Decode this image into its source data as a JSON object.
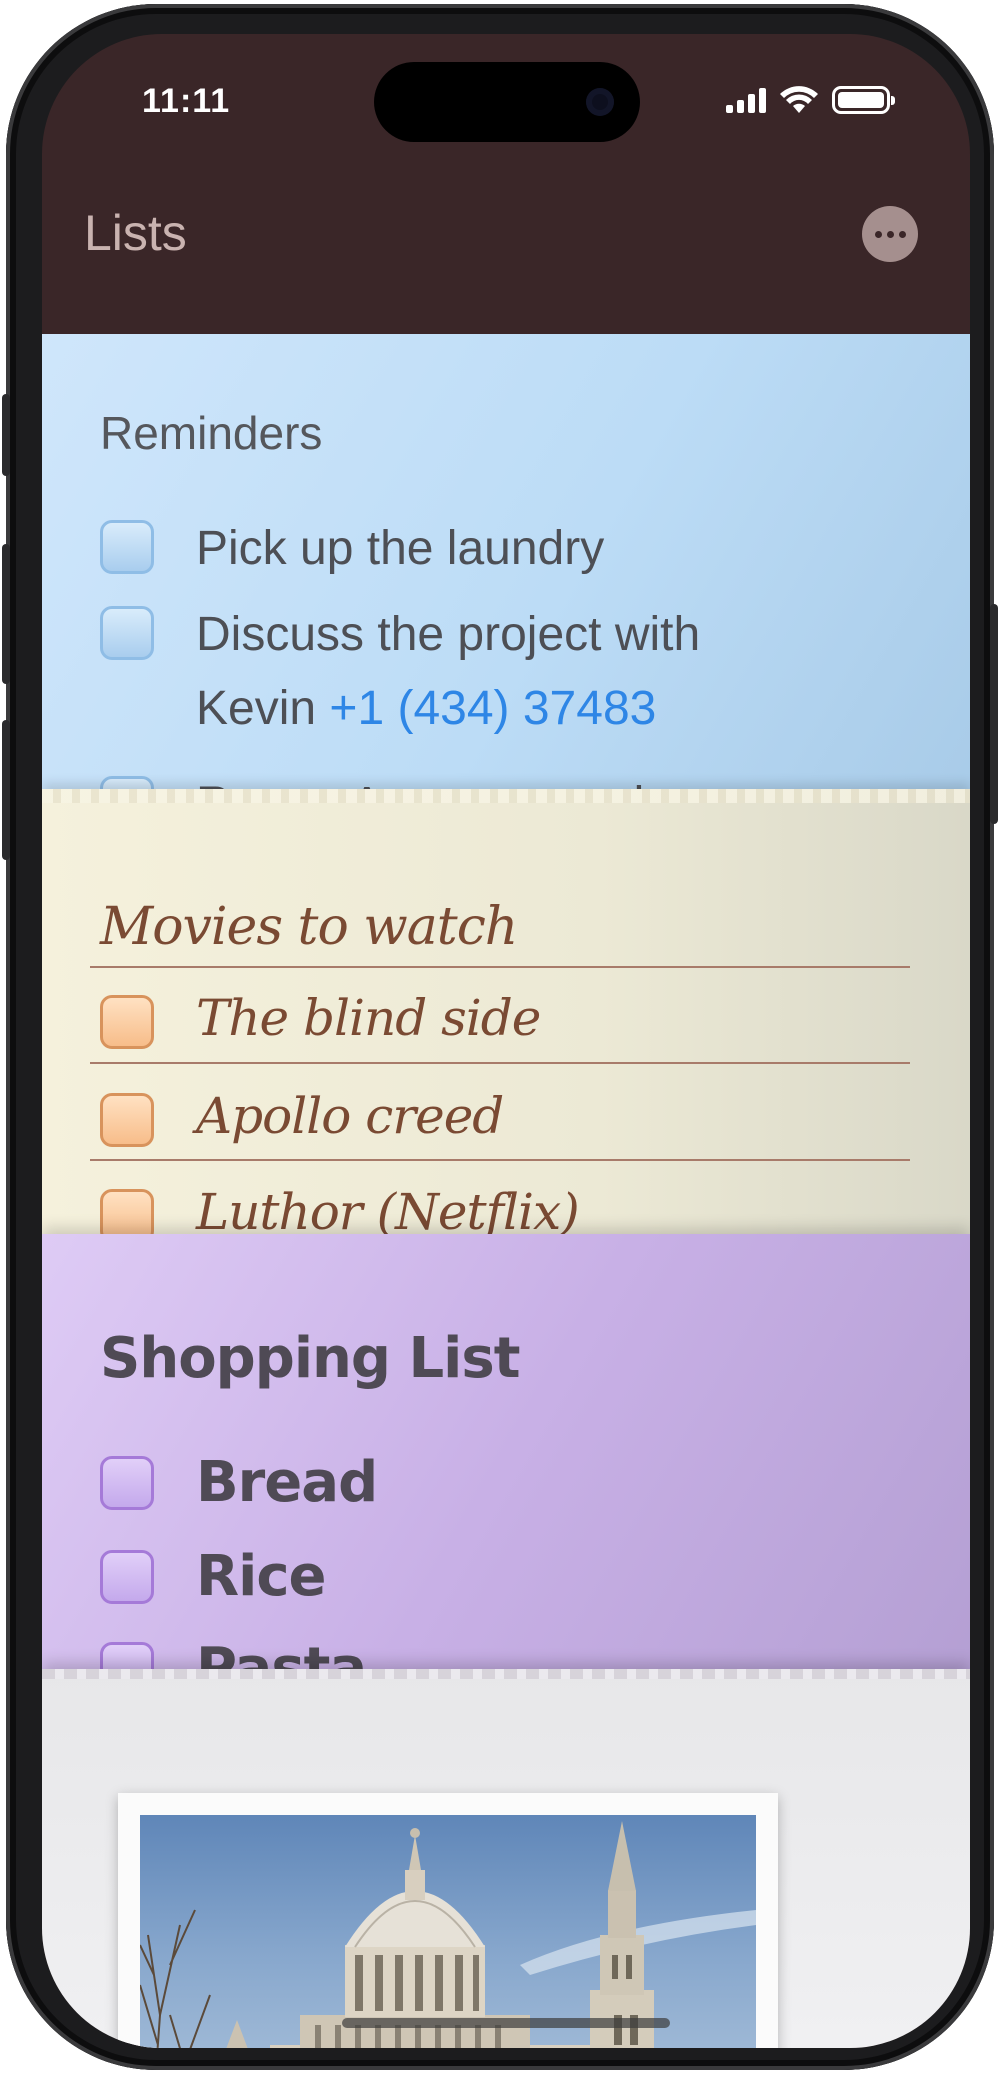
{
  "status_bar": {
    "time": "11:11"
  },
  "nav": {
    "title": "Lists"
  },
  "reminders": {
    "title": "Reminders",
    "items": [
      {
        "text": "Pick up the laundry"
      },
      {
        "text_line1": "Discuss the project with",
        "text_line2_prefix": "Kevin ",
        "phone_number": "+1 (434) 37483"
      }
    ],
    "partial_item": "Return Amazon purchase"
  },
  "movies": {
    "title": "Movies to watch",
    "items": [
      "The blind side",
      "Apollo creed",
      "Luthor (Netflix)"
    ]
  },
  "shopping": {
    "title": "Shopping List",
    "items": [
      "Bread",
      "Rice",
      "Pasta"
    ]
  },
  "colors": {
    "nav_background": "#3a2628",
    "reminders_card": "#c7e2f8",
    "movies_card": "#f1eedb",
    "shopping_card": "#cfb9ec",
    "link": "#2e86e6"
  },
  "icons": {
    "more": "ellipsis-circle-icon",
    "signal": "cellular-signal-icon",
    "wifi": "wifi-icon",
    "battery": "battery-icon"
  }
}
